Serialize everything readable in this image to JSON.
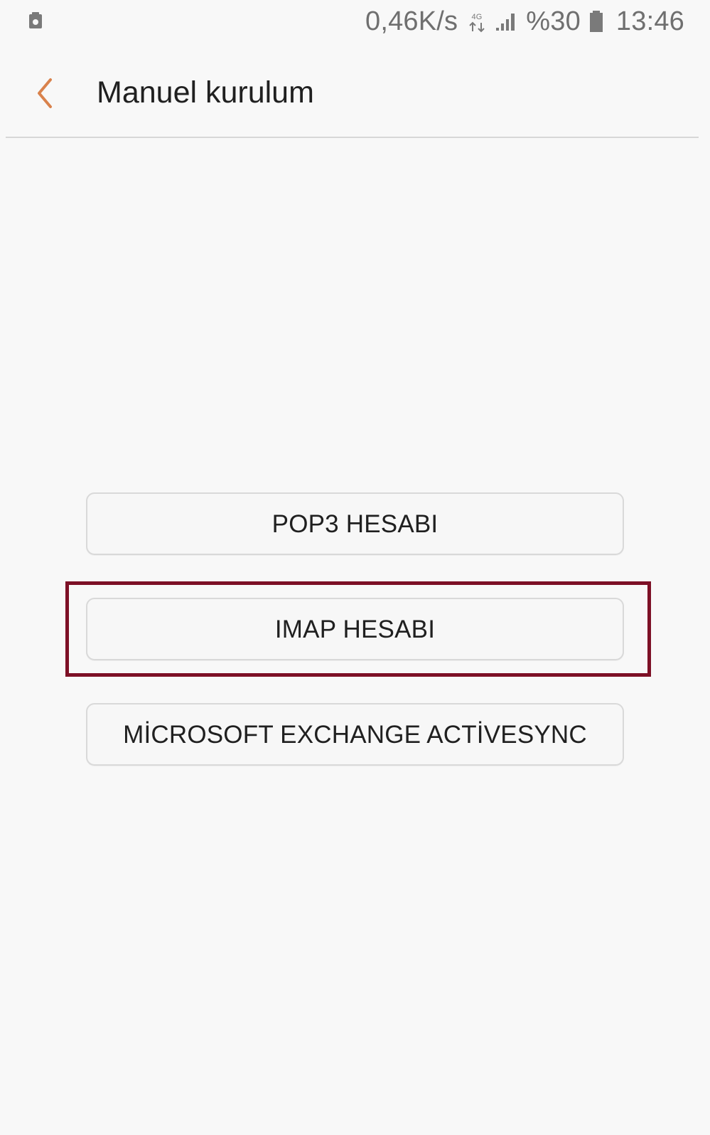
{
  "status_bar": {
    "network_speed": "0,46K/s",
    "network_type": "4G",
    "battery_percent": "%30",
    "time": "13:46",
    "left_icon": "notification-icon",
    "signal_icon": "signal-icon",
    "battery_icon": "battery-icon"
  },
  "header": {
    "back_icon": "chevron-left-icon",
    "title": "Manuel kurulum"
  },
  "options": [
    {
      "label": "POP3 HESABI"
    },
    {
      "label": "IMAP HESABI"
    },
    {
      "label": "MİCROSOFT EXCHANGE ACTİVESYNC"
    }
  ],
  "highlight": {
    "target": "IMAP HESABI",
    "color": "#7d1026"
  },
  "colors": {
    "background": "#f8f8f8",
    "accent_orange": "#d9824c",
    "status_text": "#6f6f6f",
    "button_border": "#d9d9d9"
  }
}
